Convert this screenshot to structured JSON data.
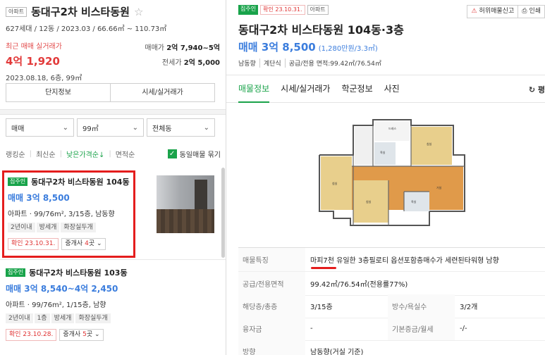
{
  "left": {
    "type_tag": "아파트",
    "title": "동대구2차 비스타동원",
    "star_icon": "star-outline-icon",
    "subtitle": "627세대 / 12동 / 2023.03 / 66.66㎡ ~ 110.73㎡",
    "recent_label": "최근 매매 실거래가",
    "recent_price": "4억 1,920",
    "recent_date": "2023.08.18, 6층, 99㎡",
    "ranges": {
      "sale_label": "매매가",
      "sale_value": "2억 7,940~5억",
      "jeonse_label": "전세가",
      "jeonse_value": "2억 5,000"
    },
    "tabs": [
      "단지정보",
      "시세/실거래가"
    ],
    "filters": [
      "매매",
      "99㎡",
      "전체동"
    ],
    "sort": {
      "options": [
        "랭킹순",
        "최신순",
        "낮은가격순↓",
        "면적순"
      ],
      "active_index": 2,
      "checkbox_label": "동일매물 묶기",
      "checkbox_checked": true
    },
    "listings": [
      {
        "badge": "집주인",
        "title": "동대구2차 비스타동원 104동",
        "price": "매매 3억 8,500",
        "info": "아파트 · 99/76m², 3/15층, 남동향",
        "chips": [
          "2년이내",
          "방세개",
          "화장실두개"
        ],
        "date": "확인 23.10.31.",
        "agent_prefix": "중개사 ",
        "agent_count": "4",
        "agent_suffix": "곳"
      },
      {
        "badge": "집주인",
        "title": "동대구2차 비스타동원 103동",
        "price": "매매 3억 8,540~4억 2,450",
        "info": "아파트 · 99/76m², 1/15층, 남향",
        "chips": [
          "2년이내",
          "1층",
          "방세개",
          "화장실두개"
        ],
        "date": "확인 23.10.28.",
        "agent_prefix": "중개사 ",
        "agent_count": "5",
        "agent_suffix": "곳"
      }
    ]
  },
  "right": {
    "tags": [
      "집주인",
      "확인 23.10.31.",
      "아파트"
    ],
    "actions": [
      {
        "icon": "siren-icon",
        "label": "허위매물신고"
      },
      {
        "icon": "print-icon",
        "label": "인쇄"
      }
    ],
    "title": "동대구2차 비스타동원 104동·3층",
    "price": "매매 3억 8,500",
    "price_per": "(1,280만원/3.3㎡)",
    "specs": [
      "남동향",
      "계단식",
      "공급/전용 면적:99.42㎡/76.54㎡"
    ],
    "tabs": [
      "매물정보",
      "시세/실거래가",
      "학군정보",
      "사진"
    ],
    "active_tab": 0,
    "refresh_label": "↻ 평",
    "details": {
      "feature_label": "매물특징",
      "feature_value": "마피7천 유일한 3층필로티 옵션포함층매수가 세련된타워형 남향",
      "area_label": "공급/전용면적",
      "area_value": "99.42㎡/76.54㎡(전용률77%)",
      "floor_label": "해당층/총층",
      "floor_value": "3/15층",
      "rooms_label": "방수/욕실수",
      "rooms_value": "3/2개",
      "loan_label": "융자금",
      "loan_value": "-",
      "deposit_label": "기본증금/월세",
      "deposit_value": "-/-",
      "direction_label": "방향",
      "direction_value": "남동향(거실 기준)"
    }
  }
}
